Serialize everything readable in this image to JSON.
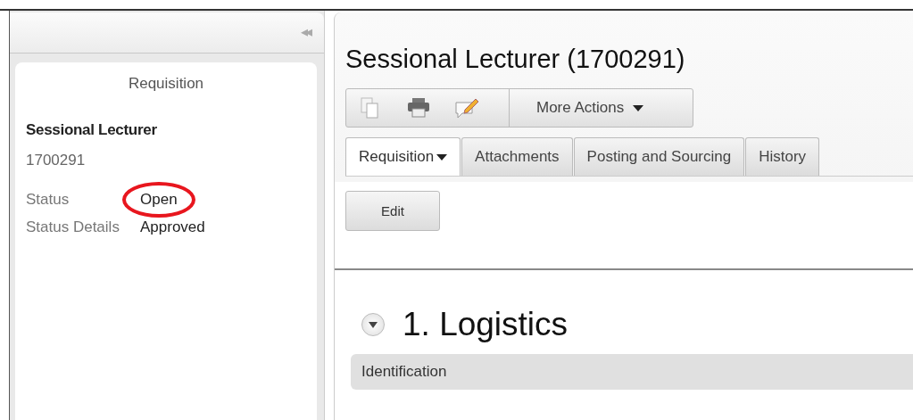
{
  "sidebar": {
    "collapse_icon": "◂◂",
    "card_title": "Requisition",
    "job_title": "Sessional Lecturer",
    "job_number": "1700291",
    "fields": [
      {
        "label": "Status",
        "value": "Open",
        "highlighted": true
      },
      {
        "label": "Status Details",
        "value": "Approved",
        "highlighted": false
      }
    ]
  },
  "main": {
    "title": "Sessional Lecturer (1700291)",
    "toolbar": {
      "more_actions": "More Actions"
    },
    "tabs": [
      {
        "label": "Requisition",
        "selected": true,
        "has_menu": true
      },
      {
        "label": "Attachments",
        "selected": false,
        "has_menu": false
      },
      {
        "label": "Posting and Sourcing",
        "selected": false,
        "has_menu": false
      },
      {
        "label": "History",
        "selected": false,
        "has_menu": false
      }
    ],
    "edit_button": "Edit",
    "section": {
      "title": "1. Logistics",
      "expanded": true,
      "subsection": "Identification"
    }
  }
}
